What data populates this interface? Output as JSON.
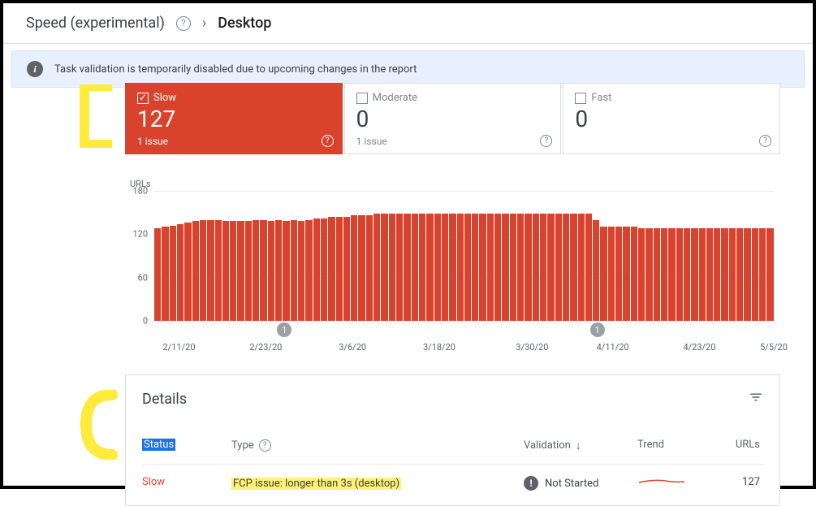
{
  "header": {
    "title": "Speed (experimental)",
    "crumb": "Desktop"
  },
  "banner": {
    "text": "Task validation is temporarily disabled due to upcoming changes in the report"
  },
  "cards": {
    "slow": {
      "label": "Slow",
      "value": "127",
      "sub": "1 issue"
    },
    "moderate": {
      "label": "Moderate",
      "value": "0",
      "sub": "1 issue"
    },
    "fast": {
      "label": "Fast",
      "value": "0",
      "sub": ""
    }
  },
  "chart_data": {
    "type": "bar",
    "ylabel": "URLs",
    "yticks": [
      "180",
      "120",
      "60",
      "0"
    ],
    "ylim": [
      0,
      180
    ],
    "xticks": [
      "2/11/20",
      "2/23/20",
      "3/6/20",
      "3/18/20",
      "3/30/20",
      "4/11/20",
      "5/5/20"
    ],
    "values": [
      128,
      130,
      132,
      134,
      136,
      138,
      140,
      140,
      140,
      138,
      138,
      138,
      138,
      140,
      140,
      138,
      140,
      138,
      140,
      138,
      140,
      142,
      142,
      144,
      144,
      144,
      146,
      146,
      146,
      148,
      148,
      148,
      148,
      148,
      148,
      148,
      148,
      148,
      148,
      148,
      148,
      148,
      148,
      148,
      148,
      148,
      148,
      148,
      148,
      148,
      148,
      148,
      148,
      148,
      148,
      148,
      148,
      148,
      140,
      130,
      130,
      130,
      130,
      130,
      128,
      128,
      128,
      128,
      128,
      128,
      128,
      128,
      128,
      128,
      128,
      128,
      128,
      128,
      128,
      128,
      128,
      128
    ]
  },
  "details": {
    "title": "Details",
    "columns": {
      "status": "Status",
      "type": "Type",
      "validation": "Validation",
      "trend": "Trend",
      "urls": "URLs"
    },
    "row": {
      "status": "Slow",
      "type": "FCP issue: longer than 3s (desktop)",
      "validation": "Not Started",
      "urls": "127"
    }
  },
  "x_tick_positions": [
    4,
    18,
    32,
    46,
    61,
    74,
    100
  ],
  "markers": [
    {
      "pos": 21,
      "label": "1"
    },
    {
      "pos": 71.5,
      "label": "1"
    }
  ],
  "extra_xtick": {
    "pos": 88,
    "label": "4/23/20"
  }
}
